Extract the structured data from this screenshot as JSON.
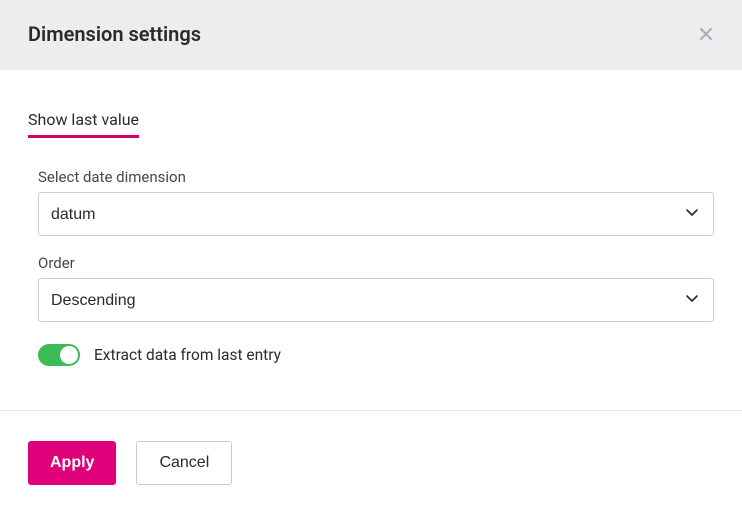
{
  "header": {
    "title": "Dimension settings"
  },
  "tab": {
    "show_last_value": "Show last value"
  },
  "fields": {
    "date_dimension": {
      "label": "Select date dimension",
      "value": "datum"
    },
    "order": {
      "label": "Order",
      "value": "Descending"
    },
    "extract": {
      "label": "Extract data from last entry",
      "on": true
    }
  },
  "footer": {
    "apply": "Apply",
    "cancel": "Cancel"
  }
}
